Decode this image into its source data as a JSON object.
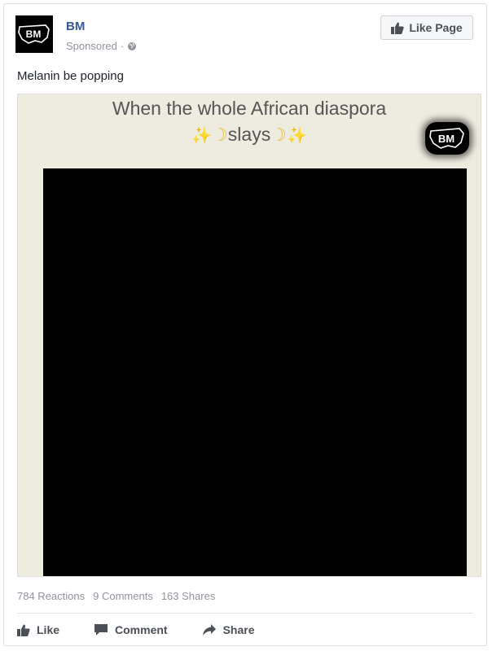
{
  "post": {
    "page_name": "BM",
    "avatar_text": "BM",
    "sponsored_label": "Sponsored",
    "separator": "·",
    "like_page_label": "Like Page",
    "text": "Melanin be popping"
  },
  "media": {
    "caption_line1": "When the whole African diaspora",
    "caption_word": "slays",
    "watermark_text": "BM"
  },
  "stats": {
    "reactions": "784 Reactions",
    "comments": "9 Comments",
    "shares": "163 Shares"
  },
  "actions": {
    "like": "Like",
    "comment": "Comment",
    "share": "Share"
  },
  "icons": {
    "thumbs_up": "thumbs-up-icon",
    "globe": "globe-icon",
    "comment": "comment-bubble-icon",
    "share": "share-arrow-icon"
  },
  "colors": {
    "page_link": "#365899",
    "meta_gray": "#90949c",
    "button_bg": "#f6f7f9",
    "media_bg": "#eeebdf",
    "sparkle": "#e8c65a"
  }
}
